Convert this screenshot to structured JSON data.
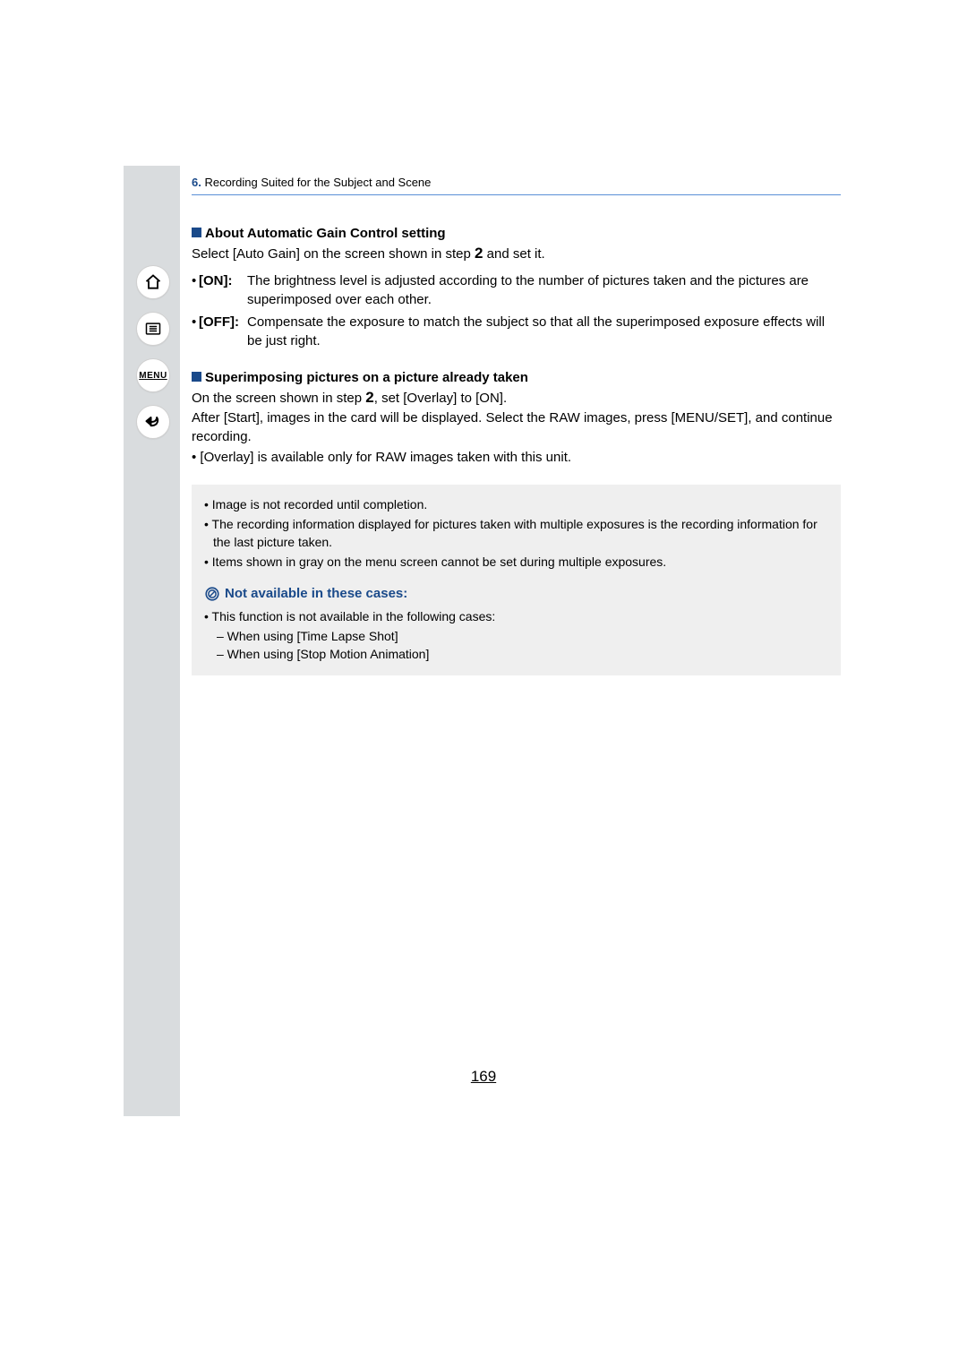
{
  "breadcrumb": {
    "chapter_num": "6.",
    "chapter_title": " Recording Suited for the Subject and Scene"
  },
  "nav": {
    "menu_label": "MENU"
  },
  "section1": {
    "heading": "About Automatic Gain Control setting",
    "intro_a": "Select [Auto Gain] on the screen shown in step ",
    "step": "2",
    "intro_b": " and set it.",
    "options": [
      {
        "label": "[ON]:",
        "desc": "The brightness level is adjusted according to the number of pictures taken and the pictures are superimposed over each other."
      },
      {
        "label": "[OFF]:",
        "desc": "Compensate the exposure to match the subject so that all the superimposed exposure effects will be just right."
      }
    ]
  },
  "section2": {
    "heading": "Superimposing pictures on a picture already taken",
    "line1_a": "On the screen shown in step ",
    "step": "2",
    "line1_b": ", set [Overlay] to [ON].",
    "line2": "After [Start], images in the card will be displayed. Select the RAW images, press [MENU/SET], and continue recording.",
    "bullet": "• [Overlay] is available only for RAW images taken with this unit."
  },
  "note_box": {
    "items": [
      "• Image is not recorded until completion.",
      "• The recording information displayed for pictures taken with multiple exposures is the recording information for the last picture taken.",
      "• Items shown in gray on the menu screen cannot be set during multiple exposures."
    ],
    "na_heading": "Not available in these cases:",
    "na_intro": "• This function is not available in the following cases:",
    "na_items": [
      "– When using [Time Lapse Shot]",
      "– When using [Stop Motion Animation]"
    ]
  },
  "page_number": "169"
}
